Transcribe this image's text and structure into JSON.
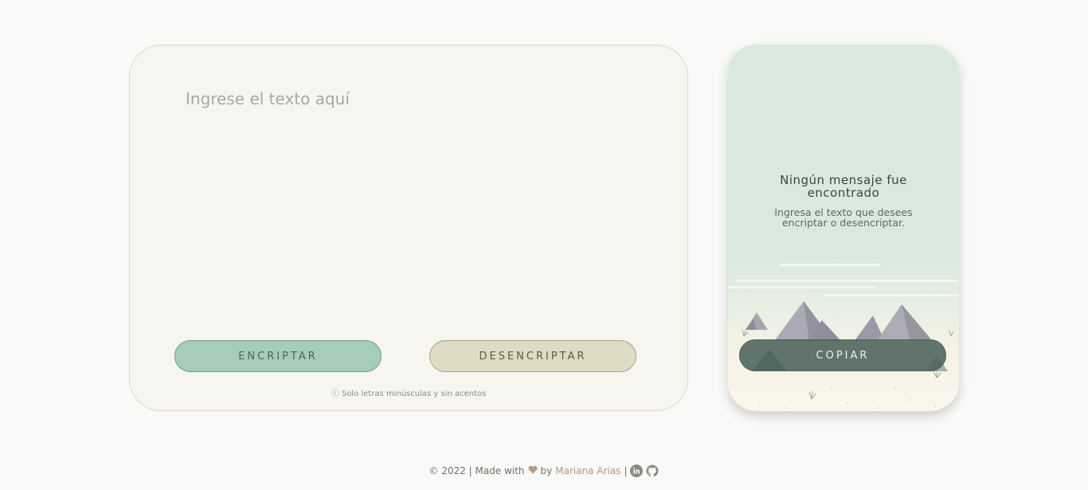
{
  "input": {
    "placeholder": "Ingrese el texto aquí",
    "encrypt_label": "ENCRIPTAR",
    "decrypt_label": "DESENCRIPTAR",
    "hint_icon": "ⓘ",
    "hint_text": "Solo letras minúsculas y sin acentos"
  },
  "output": {
    "title": "Ningún mensaje fue encontrado",
    "description": "Ingresa el texto que desees encriptar o desencriptar.",
    "copy_label": "COPIAR"
  },
  "footer": {
    "prefix": "© 2022 | Made with",
    "by": "by",
    "author": "Mariana Arias",
    "separator": "|",
    "icons": [
      "heart-icon",
      "linkedin-icon",
      "github-icon"
    ]
  },
  "colors": {
    "encrypt_bg": "#a6cdb7",
    "decrypt_bg": "#dfdbc5",
    "copy_bg": "#5a6e67",
    "output_bg": "#d9e9de"
  }
}
